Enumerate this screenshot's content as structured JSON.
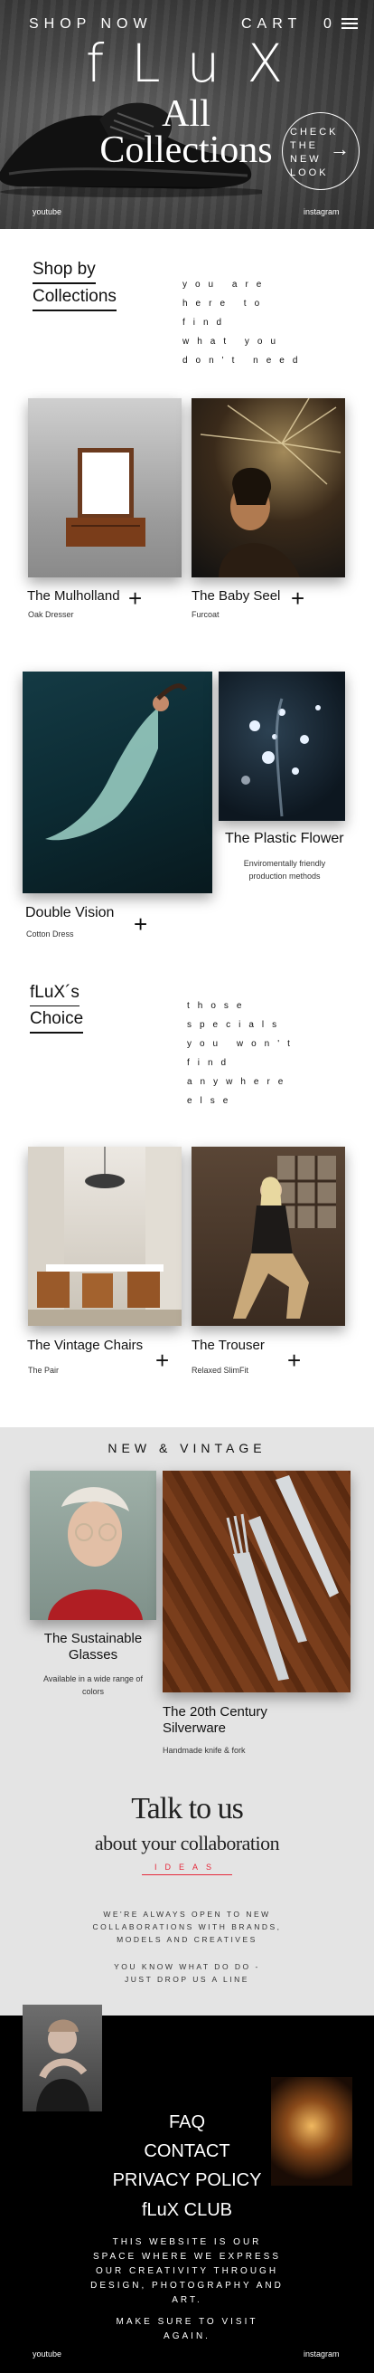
{
  "nav": {
    "shop": "SHOP NOW",
    "cart": "CART",
    "cart_count": "0",
    "menu_icon": "hamburger-icon"
  },
  "hero": {
    "logo": "fLuX",
    "title_line1": "All",
    "title_line2": "Collections",
    "cta": "CHECK THE NEW LOOK",
    "cta_lines": [
      "CHECK",
      "THE",
      "NEW",
      "LOOK"
    ],
    "cta_icon": "arrow-right-icon",
    "youtube": "youtube",
    "instagram": "instagram"
  },
  "shop_by": {
    "line1": "Shop by",
    "line2": "Collections",
    "tagline": "you are\nhere to\nfind\nwhat you\ndon't need"
  },
  "products1": [
    {
      "name": "The Mulholland",
      "sub": "Oak Dresser"
    },
    {
      "name": "The Baby Seel",
      "sub": "Furcoat"
    }
  ],
  "products2": [
    {
      "name": "Double Vision",
      "sub": "Cotton Dress"
    },
    {
      "name": "The Plastic Flower",
      "sub": "Enviromentally friendly production methods"
    }
  ],
  "choice": {
    "line1": "fLuX´s",
    "line2": "Choice",
    "tagline": "those\nspecials\nyou won't\nfind\nanywhere\nelse"
  },
  "products3": [
    {
      "name": "The Vintage Chairs",
      "sub": "The Pair"
    },
    {
      "name": "The Trouser",
      "sub": "Relaxed SlimFit"
    }
  ],
  "new_vintage": {
    "heading": "NEW & VINTAGE",
    "items": [
      {
        "name": "The Sustainable Glasses",
        "sub": "Available in a wide range of colors"
      },
      {
        "name": "The 20th Century Silverware",
        "sub": "Handmade knife & fork"
      }
    ]
  },
  "talk": {
    "title": "Talk to us",
    "subtitle": "about your collaboration",
    "ideas": "IDEAS",
    "para1": "WE'RE ALWAYS OPEN TO NEW\nCOLLABORATIONS WITH BRANDS,\nMODELS AND CREATIVES",
    "para2": "YOU KNOW WHAT DO DO -\nJUST DROP US A LINE"
  },
  "footer": {
    "links": [
      "FAQ",
      "CONTACT",
      "PRIVACY POLICY",
      "fLuX CLUB"
    ],
    "para1": "THIS WEBSITE IS OUR\nSPACE WHERE WE EXPRESS\nOUR CREATIVITY THROUGH\nDESIGN, PHOTOGRAPHY AND\nART.",
    "para2": "MAKE SURE TO VISIT\nAGAIN.",
    "youtube": "youtube",
    "instagram": "instagram"
  },
  "colors": {
    "accent": "#e5293b",
    "gray_band": "#e4e4e4",
    "footer_bg": "#000000"
  }
}
